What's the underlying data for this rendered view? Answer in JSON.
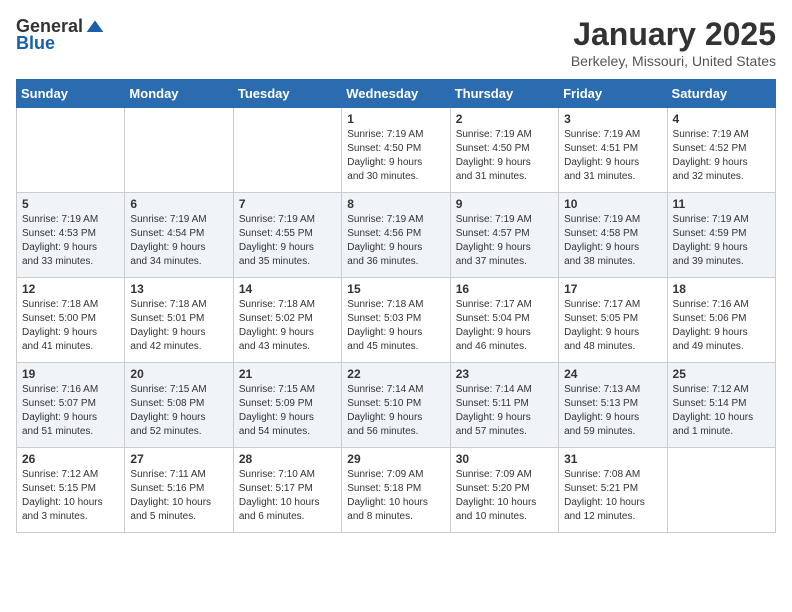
{
  "header": {
    "logo_general": "General",
    "logo_blue": "Blue",
    "month_title": "January 2025",
    "location": "Berkeley, Missouri, United States"
  },
  "weekdays": [
    "Sunday",
    "Monday",
    "Tuesday",
    "Wednesday",
    "Thursday",
    "Friday",
    "Saturday"
  ],
  "weeks": [
    [
      {
        "day": "",
        "info": ""
      },
      {
        "day": "",
        "info": ""
      },
      {
        "day": "",
        "info": ""
      },
      {
        "day": "1",
        "info": "Sunrise: 7:19 AM\nSunset: 4:50 PM\nDaylight: 9 hours\nand 30 minutes."
      },
      {
        "day": "2",
        "info": "Sunrise: 7:19 AM\nSunset: 4:50 PM\nDaylight: 9 hours\nand 31 minutes."
      },
      {
        "day": "3",
        "info": "Sunrise: 7:19 AM\nSunset: 4:51 PM\nDaylight: 9 hours\nand 31 minutes."
      },
      {
        "day": "4",
        "info": "Sunrise: 7:19 AM\nSunset: 4:52 PM\nDaylight: 9 hours\nand 32 minutes."
      }
    ],
    [
      {
        "day": "5",
        "info": "Sunrise: 7:19 AM\nSunset: 4:53 PM\nDaylight: 9 hours\nand 33 minutes."
      },
      {
        "day": "6",
        "info": "Sunrise: 7:19 AM\nSunset: 4:54 PM\nDaylight: 9 hours\nand 34 minutes."
      },
      {
        "day": "7",
        "info": "Sunrise: 7:19 AM\nSunset: 4:55 PM\nDaylight: 9 hours\nand 35 minutes."
      },
      {
        "day": "8",
        "info": "Sunrise: 7:19 AM\nSunset: 4:56 PM\nDaylight: 9 hours\nand 36 minutes."
      },
      {
        "day": "9",
        "info": "Sunrise: 7:19 AM\nSunset: 4:57 PM\nDaylight: 9 hours\nand 37 minutes."
      },
      {
        "day": "10",
        "info": "Sunrise: 7:19 AM\nSunset: 4:58 PM\nDaylight: 9 hours\nand 38 minutes."
      },
      {
        "day": "11",
        "info": "Sunrise: 7:19 AM\nSunset: 4:59 PM\nDaylight: 9 hours\nand 39 minutes."
      }
    ],
    [
      {
        "day": "12",
        "info": "Sunrise: 7:18 AM\nSunset: 5:00 PM\nDaylight: 9 hours\nand 41 minutes."
      },
      {
        "day": "13",
        "info": "Sunrise: 7:18 AM\nSunset: 5:01 PM\nDaylight: 9 hours\nand 42 minutes."
      },
      {
        "day": "14",
        "info": "Sunrise: 7:18 AM\nSunset: 5:02 PM\nDaylight: 9 hours\nand 43 minutes."
      },
      {
        "day": "15",
        "info": "Sunrise: 7:18 AM\nSunset: 5:03 PM\nDaylight: 9 hours\nand 45 minutes."
      },
      {
        "day": "16",
        "info": "Sunrise: 7:17 AM\nSunset: 5:04 PM\nDaylight: 9 hours\nand 46 minutes."
      },
      {
        "day": "17",
        "info": "Sunrise: 7:17 AM\nSunset: 5:05 PM\nDaylight: 9 hours\nand 48 minutes."
      },
      {
        "day": "18",
        "info": "Sunrise: 7:16 AM\nSunset: 5:06 PM\nDaylight: 9 hours\nand 49 minutes."
      }
    ],
    [
      {
        "day": "19",
        "info": "Sunrise: 7:16 AM\nSunset: 5:07 PM\nDaylight: 9 hours\nand 51 minutes."
      },
      {
        "day": "20",
        "info": "Sunrise: 7:15 AM\nSunset: 5:08 PM\nDaylight: 9 hours\nand 52 minutes."
      },
      {
        "day": "21",
        "info": "Sunrise: 7:15 AM\nSunset: 5:09 PM\nDaylight: 9 hours\nand 54 minutes."
      },
      {
        "day": "22",
        "info": "Sunrise: 7:14 AM\nSunset: 5:10 PM\nDaylight: 9 hours\nand 56 minutes."
      },
      {
        "day": "23",
        "info": "Sunrise: 7:14 AM\nSunset: 5:11 PM\nDaylight: 9 hours\nand 57 minutes."
      },
      {
        "day": "24",
        "info": "Sunrise: 7:13 AM\nSunset: 5:13 PM\nDaylight: 9 hours\nand 59 minutes."
      },
      {
        "day": "25",
        "info": "Sunrise: 7:12 AM\nSunset: 5:14 PM\nDaylight: 10 hours\nand 1 minute."
      }
    ],
    [
      {
        "day": "26",
        "info": "Sunrise: 7:12 AM\nSunset: 5:15 PM\nDaylight: 10 hours\nand 3 minutes."
      },
      {
        "day": "27",
        "info": "Sunrise: 7:11 AM\nSunset: 5:16 PM\nDaylight: 10 hours\nand 5 minutes."
      },
      {
        "day": "28",
        "info": "Sunrise: 7:10 AM\nSunset: 5:17 PM\nDaylight: 10 hours\nand 6 minutes."
      },
      {
        "day": "29",
        "info": "Sunrise: 7:09 AM\nSunset: 5:18 PM\nDaylight: 10 hours\nand 8 minutes."
      },
      {
        "day": "30",
        "info": "Sunrise: 7:09 AM\nSunset: 5:20 PM\nDaylight: 10 hours\nand 10 minutes."
      },
      {
        "day": "31",
        "info": "Sunrise: 7:08 AM\nSunset: 5:21 PM\nDaylight: 10 hours\nand 12 minutes."
      },
      {
        "day": "",
        "info": ""
      }
    ]
  ]
}
